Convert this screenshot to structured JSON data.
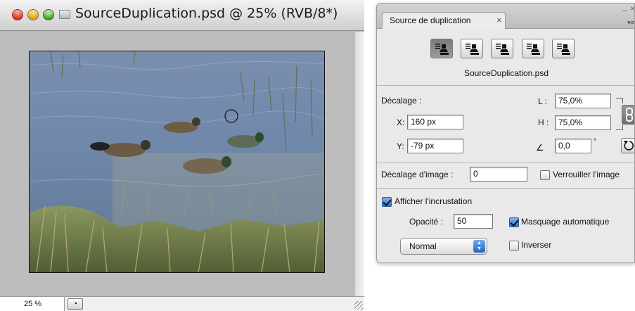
{
  "document": {
    "title": "SourceDuplication.psd @ 25% (RVB/8*)",
    "zoom": "25 %"
  },
  "panel": {
    "tab_label": "Source de duplication",
    "tab_close": "×",
    "source_buttons": [
      {
        "icon": "clone-source-icon",
        "active": true
      },
      {
        "icon": "clone-source-icon",
        "active": false
      },
      {
        "icon": "clone-source-icon",
        "active": false
      },
      {
        "icon": "clone-source-icon",
        "active": false
      },
      {
        "icon": "clone-source-icon",
        "active": false
      }
    ],
    "source_file": "SourceDuplication.psd",
    "offset": {
      "label": "Décalage :",
      "x_label": "X:",
      "x_value": "160 px",
      "y_label": "Y:",
      "y_value": "-79 px",
      "w_label": "L :",
      "w_value": "75,0%",
      "h_label": "H :",
      "h_value": "75,0%",
      "angle_value": "0,0",
      "angle_unit": "°"
    },
    "frame_offset": {
      "label": "Décalage d'image :",
      "value": "0",
      "lock_label": "Verrouiller l'image",
      "lock_checked": false
    },
    "overlay": {
      "show_label": "Afficher l'incrustation",
      "show_checked": true,
      "opacity_label": "Opacité :",
      "opacity_value": "50",
      "auto_hide_label": "Masquage automatique",
      "auto_hide_checked": true,
      "mode_value": "Normal",
      "invert_label": "Inverser",
      "invert_checked": false
    }
  }
}
